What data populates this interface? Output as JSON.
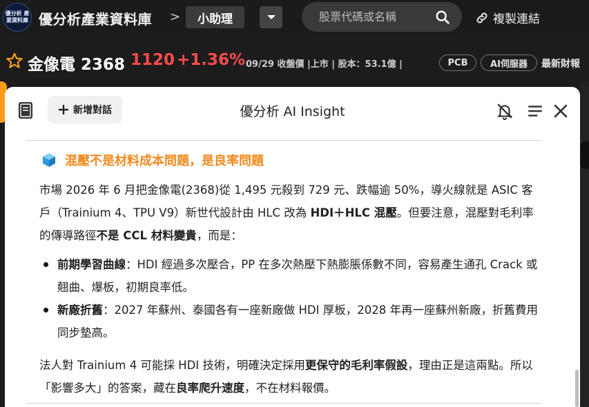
{
  "topbar": {
    "logo_text": "優分析 產業資料庫",
    "brand": "優分析產業資料庫",
    "crumb_sep": ">",
    "crumb_current": "小助理",
    "search_placeholder": "股票代碼或名稱",
    "copy_link_label": "複製連結"
  },
  "stock": {
    "name_code": "金像電 2368",
    "price": "1120",
    "change": "+1.36%",
    "meta": "09/29 收盤價 |上市 | 股本：53.1億 |",
    "tags": [
      "PCB",
      "AI伺服器"
    ],
    "more": "最新財報"
  },
  "modal": {
    "new_chat_label": "新增對話",
    "title": "優分析 AI Insight",
    "section_title": "混壓不是材料成本問題，是良率問題",
    "p1_a": "市場 2026 年 6 月把金像電(2368)從 1,495 元殺到 729 元、跌幅逾 50%，導火線就是 ASIC 客戶（Trainium 4、TPU V9）新世代設計由 HLC 改為 ",
    "p1_b": "HDI＋HLC 混壓",
    "p1_c": "。但要注意，混壓對毛利率的傳導路徑",
    "p1_d": "不是 CCL 材料變貴",
    "p1_e": "，而是：",
    "bullet1_head": "前期學習曲線",
    "bullet1_body": "：HDI 經過多次壓合，PP 在多次熱壓下熱膨脹係數不同，容易產生通孔 Crack 或翹曲、爆板，初期良率低。",
    "bullet2_head": "新廠折舊",
    "bullet2_body": "：2027 年蘇州、泰國各有一座新廠做 HDI 厚板，2028 年再一座蘇州新廠，折舊費用同步墊高。",
    "p2_a": "法人對 Trainium 4 可能採 HDI 技術，明確決定採用",
    "p2_b": "更保守的毛利率假設",
    "p2_c": "，理由正是這兩點。所以「影響多大」的答案，藏在",
    "p2_d": "良率爬升速度",
    "p2_e": "，不在材料報價。"
  },
  "colors": {
    "price_red": "#ff4b4b",
    "accent_orange": "#f08a1d",
    "topbar_bg": "#1b1b1b"
  },
  "icons": [
    "logo",
    "chevron-down-icon",
    "search-icon",
    "link-icon",
    "star-icon",
    "book-icon",
    "plus-icon",
    "bell-off-icon",
    "menu-icon",
    "close-icon",
    "cube-icon"
  ]
}
